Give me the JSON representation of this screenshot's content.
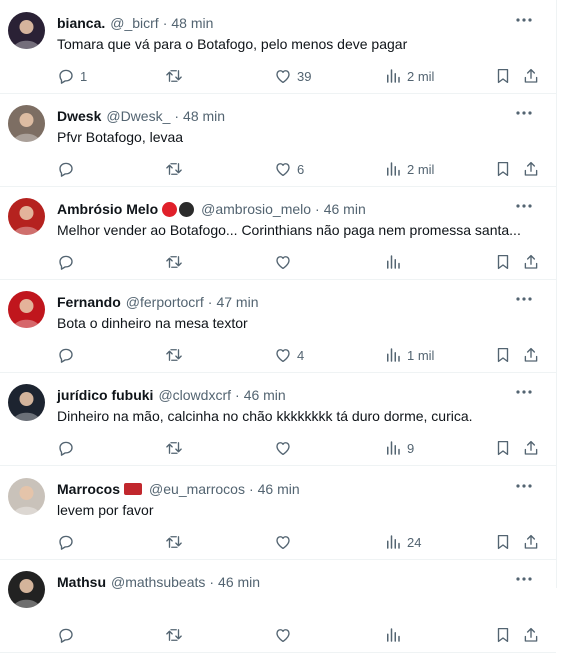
{
  "tweets": [
    {
      "name": "bianca.",
      "handle": "@_bicrf",
      "time": "48 min",
      "text": "Tomara que vá para o Botafogo, pelo menos deve pagar",
      "replies": "1",
      "retweets": "",
      "likes": "39",
      "views": "2 mil",
      "avatar_color": "#2a2135"
    },
    {
      "name": "Dwesk",
      "handle": "@Dwesk_",
      "time": "48 min",
      "text": "Pfvr Botafogo, levaa",
      "replies": "",
      "retweets": "",
      "likes": "6",
      "views": "2 mil",
      "avatar_color": "#7d6e63"
    },
    {
      "name": "Ambrósio Melo",
      "handle": "@ambrosio_melo",
      "time": "46 min",
      "text": "Melhor vender ao Botafogo... Corinthians não paga nem promessa santa...",
      "replies": "",
      "retweets": "",
      "likes": "",
      "views": "",
      "avatar_color": "#b5221f",
      "badges": [
        "#e0202a",
        "#2b2b2b"
      ]
    },
    {
      "name": "Fernando",
      "handle": "@ferportocrf",
      "time": "47 min",
      "text": "Bota o dinheiro na mesa textor",
      "replies": "",
      "retweets": "",
      "likes": "4",
      "views": "1 mil",
      "avatar_color": "#c0161d"
    },
    {
      "name": "jurídico fubuki",
      "handle": "@clowdxcrf",
      "time": "46 min",
      "text": "Dinheiro na mão, calcinha no chão kkkkkkkk tá duro dorme, curica.",
      "replies": "",
      "retweets": "",
      "likes": "",
      "views": "9",
      "avatar_color": "#1d2430"
    },
    {
      "name": "Marrocos",
      "handle": "@eu_marrocos",
      "time": "46 min",
      "text": "levem por favor",
      "replies": "",
      "retweets": "",
      "likes": "",
      "views": "24",
      "avatar_color": "#c9c2ba",
      "flag": "#c1272d"
    },
    {
      "name": "Mathsu",
      "handle": "@mathsubeats",
      "time": "46 min",
      "text": "",
      "replies": "",
      "retweets": "",
      "likes": "",
      "views": "",
      "avatar_color": "#222222"
    }
  ],
  "colors": {
    "text": "#0f1419",
    "secondary": "#536471",
    "border": "#eff3f4"
  }
}
